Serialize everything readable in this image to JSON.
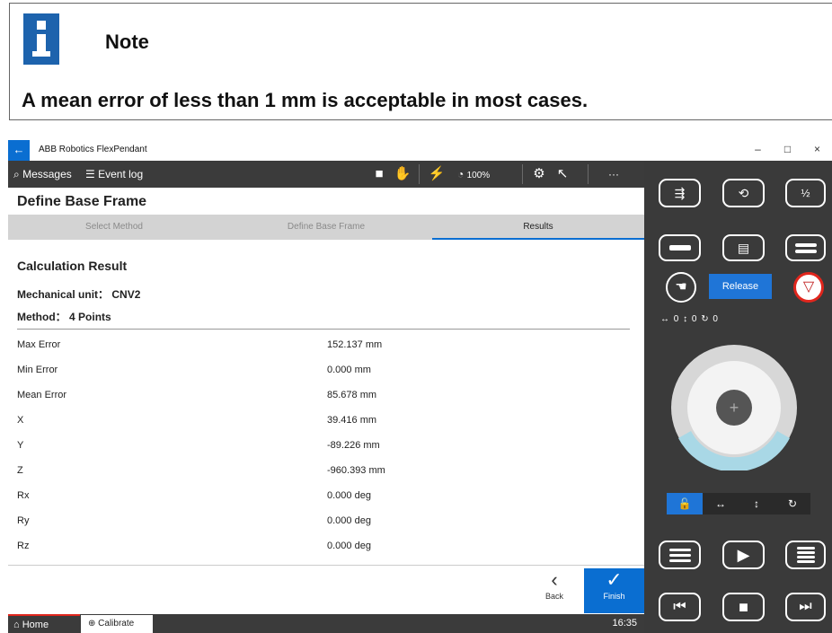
{
  "note": {
    "title": "Note",
    "text": "A mean error of less than 1 mm is acceptable in most cases."
  },
  "window": {
    "title": "ABB Robotics FlexPendant",
    "controls": [
      "–",
      "□",
      "×"
    ]
  },
  "topbar": {
    "messages": "Messages",
    "event_log": "Event log",
    "speed": "100%",
    "more": "···"
  },
  "page": {
    "title": "Define Base Frame",
    "tabs": [
      "Select Method",
      "Define Base Frame",
      "Results"
    ],
    "active_tab": "Results",
    "section": "Calculation Result",
    "mech_unit_label": "Mechanical unit：",
    "mech_unit_value": "CNV2",
    "method_label": "Method：",
    "method_value": "4 Points",
    "results": [
      {
        "label": "Max Error",
        "value": "152.137 mm"
      },
      {
        "label": "Min Error",
        "value": "0.000 mm"
      },
      {
        "label": "Mean Error",
        "value": "85.678 mm"
      },
      {
        "label": "X",
        "value": "39.416 mm"
      },
      {
        "label": "Y",
        "value": "-89.226 mm"
      },
      {
        "label": "Z",
        "value": "-960.393 mm"
      },
      {
        "label": "Rx",
        "value": "0.000 deg"
      },
      {
        "label": "Ry",
        "value": "0.000 deg"
      },
      {
        "label": "Rz",
        "value": "0.000 deg"
      }
    ],
    "back_label": "Back",
    "finish_label": "Finish"
  },
  "statusbar": {
    "home": "Home",
    "calibrate": "Calibrate",
    "time": "16:35"
  },
  "pad": {
    "release": "Release",
    "axis_readout": "↔ 0  ↕ 0  ↻ 0",
    "jog_center": "+",
    "seg_buttons": [
      "🔓",
      "↔",
      "↕",
      "↻"
    ]
  },
  "colors": {
    "accent": "#0a6ed1",
    "dark": "#3b3b3b",
    "note_icon": "#1d63ad",
    "stop_red": "#e0261d"
  }
}
